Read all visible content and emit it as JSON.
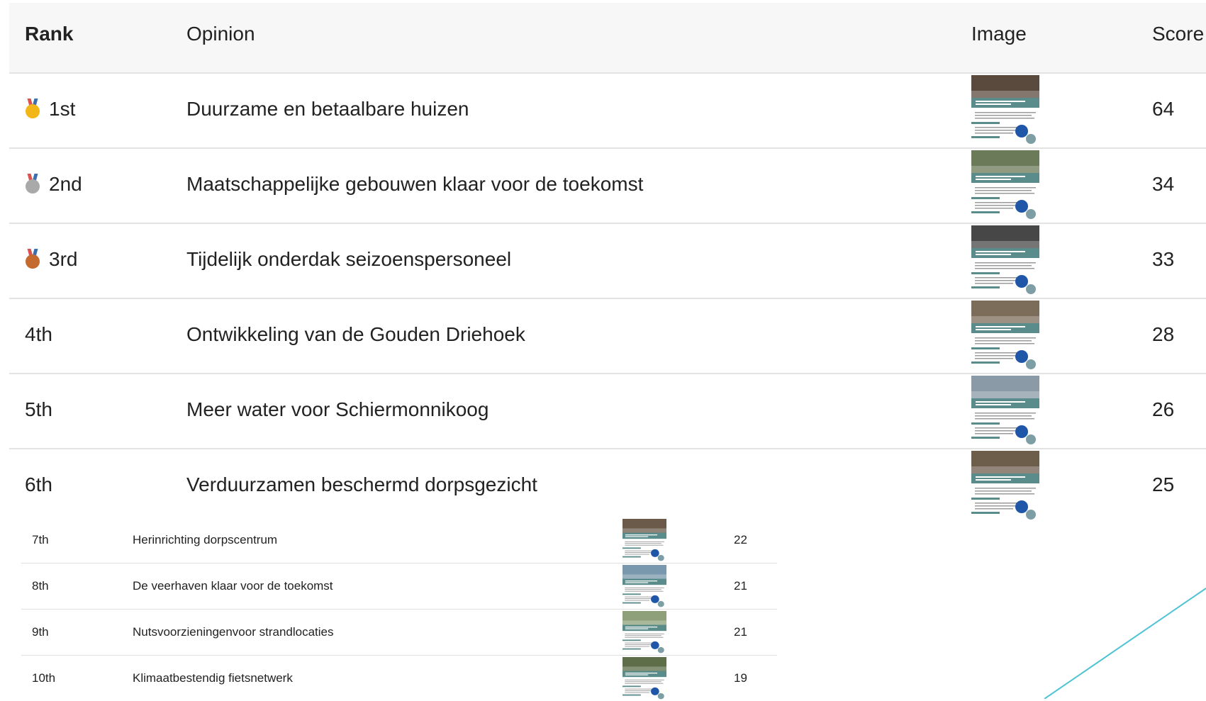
{
  "header": {
    "rank": "Rank",
    "opinion": "Opinion",
    "image": "Image",
    "score": "Score"
  },
  "rows_top": [
    {
      "rank": "1st",
      "medal": "gold",
      "opinion": "Duurzame en betaalbare huizen",
      "score": "64",
      "thumb_color": "#5a4a3e"
    },
    {
      "rank": "2nd",
      "medal": "silver",
      "opinion": "Maatschappelijke gebouwen klaar voor de toekomst",
      "score": "34",
      "thumb_color": "#6b7a58"
    },
    {
      "rank": "3rd",
      "medal": "bronze",
      "opinion": "Tijdelijk onderdak seizoenspersoneel",
      "score": "33",
      "thumb_color": "#474747"
    },
    {
      "rank": "4th",
      "medal": "",
      "opinion": "Ontwikkeling van de Gouden Driehoek",
      "score": "28",
      "thumb_color": "#7b6d5a"
    },
    {
      "rank": "5th",
      "medal": "",
      "opinion": "Meer water voor Schiermonnikoog",
      "score": "26",
      "thumb_color": "#8a9aa6"
    },
    {
      "rank": "6th",
      "medal": "",
      "opinion": "Verduurzamen beschermd dorpsgezicht",
      "score": "25",
      "thumb_color": "#6d5e4c"
    }
  ],
  "rows_bottom": [
    {
      "rank": "7th",
      "opinion": "Herinrichting dorpscentrum",
      "score": "22",
      "thumb_color": "#6b5a4a"
    },
    {
      "rank": "8th",
      "opinion": "De veerhaven klaar voor de toekomst",
      "score": "21",
      "thumb_color": "#7a98ad"
    },
    {
      "rank": "9th",
      "opinion": "Nutsvoorzieningenvoor strandlocaties",
      "score": "21",
      "thumb_color": "#8da07a"
    },
    {
      "rank": "10th",
      "opinion": "Klimaatbestendig fietsnetwerk",
      "score": "19",
      "thumb_color": "#5d6e48"
    }
  ],
  "colors": {
    "accent_teal": "#5b8c8c",
    "badge_blue": "#1f56a8",
    "diagonal_line": "#4fc3d3"
  },
  "icons": {
    "thumb_badge": "thumb-badge-icon",
    "medal_gold": "gold-medal-icon",
    "medal_silver": "silver-medal-icon",
    "medal_bronze": "bronze-medal-icon"
  }
}
